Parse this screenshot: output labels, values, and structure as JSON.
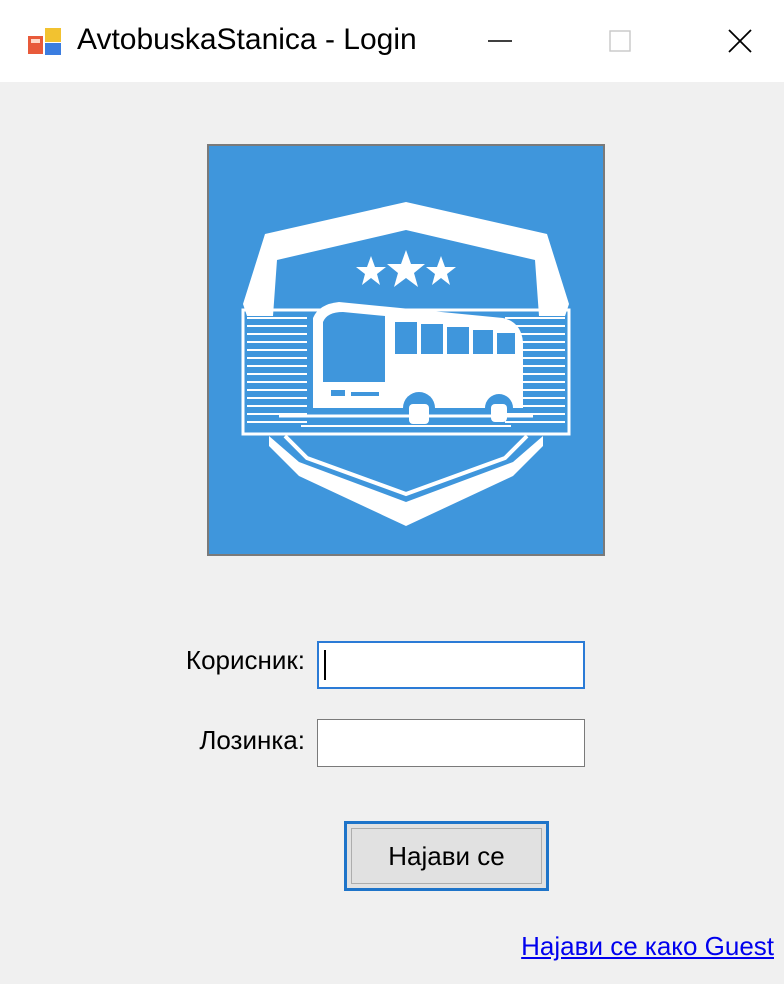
{
  "window": {
    "title": "AvtobuskaStanica - Login",
    "icon": "winforms-app-icon",
    "controls": [
      "minimize-icon",
      "maximize-icon",
      "close-icon"
    ]
  },
  "logo": {
    "description_icon": "bus-shield-logo",
    "background_color": "#3f96dc",
    "stars": 3
  },
  "form": {
    "username_label": "Корисник:",
    "username_value": "",
    "password_label": "Лозинка:",
    "password_value": "",
    "login_button": "Најави се",
    "guest_link": "Најави се како Guest"
  },
  "colors": {
    "accent": "#1e74c9",
    "link": "#0000ee",
    "background": "#f0f0f0"
  }
}
